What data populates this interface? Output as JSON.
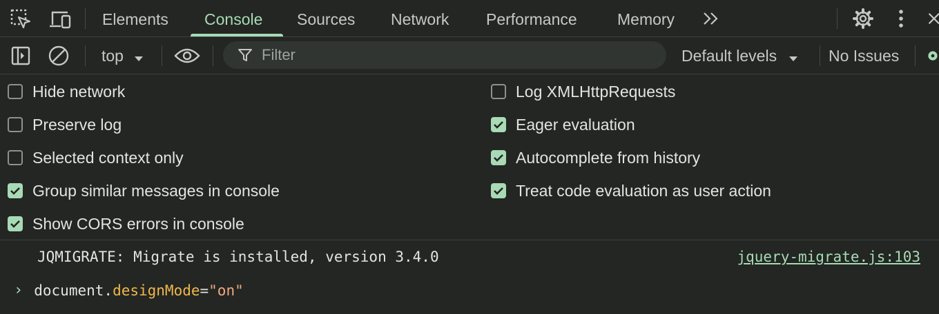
{
  "tabs": [
    {
      "label": "Elements",
      "active": false
    },
    {
      "label": "Console",
      "active": true
    },
    {
      "label": "Sources",
      "active": false
    },
    {
      "label": "Network",
      "active": false
    },
    {
      "label": "Performance",
      "active": false
    },
    {
      "label": "Memory",
      "active": false
    }
  ],
  "toolbar": {
    "context": "top",
    "filter_placeholder": "Filter",
    "levels": "Default levels",
    "issues": "No Issues"
  },
  "settings": {
    "left": [
      {
        "label": "Hide network",
        "checked": false
      },
      {
        "label": "Preserve log",
        "checked": false
      },
      {
        "label": "Selected context only",
        "checked": false
      },
      {
        "label": "Group similar messages in console",
        "checked": true
      },
      {
        "label": "Show CORS errors in console",
        "checked": true
      }
    ],
    "right": [
      {
        "label": "Log XMLHttpRequests",
        "checked": false
      },
      {
        "label": "Eager evaluation",
        "checked": true
      },
      {
        "label": "Autocomplete from history",
        "checked": true
      },
      {
        "label": "Treat code evaluation as user action",
        "checked": true
      }
    ]
  },
  "console": {
    "message": "JQMIGRATE: Migrate is installed, version 3.4.0",
    "source": "jquery-migrate.js:103",
    "input": {
      "object": "document",
      "dot": ".",
      "property": "designMode",
      "operator": "=",
      "value": "\"on\""
    }
  },
  "colors": {
    "accent": "#a8dab5",
    "background": "#232623",
    "property": "#f0b849",
    "string": "#f5a97f"
  }
}
